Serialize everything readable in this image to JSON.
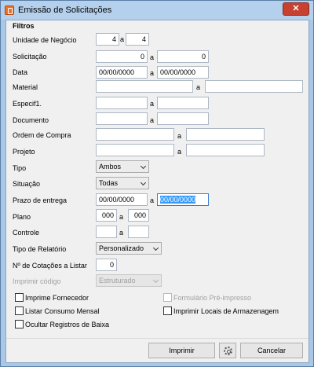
{
  "window": {
    "title": "Emissão de Solicitações",
    "close_glyph": "✕"
  },
  "group": {
    "title": "Filtros"
  },
  "labels": {
    "unidade": "Unidade de Negócio",
    "solicitacao": "Solicitação",
    "data": "Data",
    "material": "Material",
    "especif": "Especif1.",
    "documento": "Documento",
    "ordem": "Ordem de Compra",
    "projeto": "Projeto",
    "tipo": "Tipo",
    "situacao": "Situação",
    "prazo": "Prazo de entrega",
    "plano": "Plano",
    "controle": "Controle",
    "tipo_relatorio": "Tipo de Relatório",
    "n_cotacoes": "Nº de Cotações a Listar",
    "imprimir_codigo": "Imprimir código",
    "range_sep": "a"
  },
  "fields": {
    "unidade_from": "4",
    "unidade_to": "4",
    "solicitacao_from": "0",
    "solicitacao_to": "0",
    "data_from": "00/00/0000",
    "data_to": "00/00/0000",
    "material_from": "",
    "material_to": "",
    "especif_from": "",
    "especif_to": "",
    "documento_from": "",
    "documento_to": "",
    "ordem_from": "",
    "ordem_to": "",
    "projeto_from": "",
    "projeto_to": "",
    "prazo_from": "00/00/0000",
    "prazo_to": "00/00/0000",
    "plano_from": "000",
    "plano_to": "000",
    "controle_from": "",
    "controle_to": "",
    "n_cotacoes": "0"
  },
  "combos": {
    "tipo": "Ambos",
    "situacao": "Todas",
    "tipo_relatorio": "Personalizado",
    "imprimir_codigo": "Estruturado"
  },
  "checkboxes": {
    "imprime_fornecedor": "Imprime Fornecedor",
    "formulario_preimpresso": "Formulário Pré-impresso",
    "listar_consumo": "Listar Consumo Mensal",
    "imprimir_locais": "Imprimir Locais de Armazenagem",
    "ocultar_baixa": "Ocultar Registros de Baixa"
  },
  "buttons": {
    "imprimir": "Imprimir",
    "cancelar": "Cancelar"
  },
  "icons": {
    "app": "app-icon",
    "settings": "gear-icon"
  },
  "colors": {
    "titlebar": "#b5d0ec",
    "close": "#c8402f",
    "selection": "#3399ff"
  }
}
